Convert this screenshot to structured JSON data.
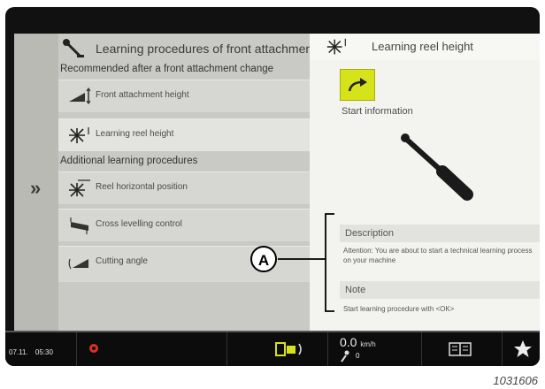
{
  "left_panel": {
    "title": "Learning procedures of front attachmen",
    "recommended_label": "Recommended after a front attachment change",
    "additional_label": "Additional learning procedures",
    "items": [
      {
        "label": "Front attachment height",
        "icon": "front-attachment-height-icon"
      },
      {
        "label": "Learning reel height",
        "icon": "reel-height-icon"
      },
      {
        "label": "Reel horizontal position",
        "icon": "reel-horizontal-icon"
      },
      {
        "label": "Cross levelling control",
        "icon": "cross-levelling-icon"
      },
      {
        "label": "Cutting angle",
        "icon": "cutting-angle-icon"
      }
    ]
  },
  "right_panel": {
    "title": "Learning reel height",
    "start_information": "Start information",
    "description_heading": "Description",
    "description_text": "Attention: You are about to start a technical learning process on your machine",
    "note_heading": "Note",
    "note_text": "Start learning procedure with <OK>"
  },
  "status_bar": {
    "date": "07.11.",
    "time": "05:30",
    "speed_value": "0.0",
    "speed_unit": "km/h",
    "secondary_value": "0"
  },
  "callout": {
    "letter": "A"
  },
  "reference_number": "1031606",
  "colors": {
    "accent": "#d6e21a",
    "alert": "#e0301e"
  }
}
